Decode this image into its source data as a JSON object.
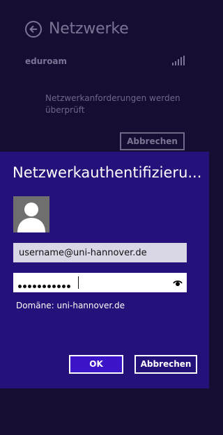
{
  "networks": {
    "title": "Netzwerke",
    "network_name": "eduroam",
    "status_text": "Netzwerkanforderungen werden überprüft",
    "cancel_label": "Abbrechen",
    "icons": {
      "back": "back-arrow-icon",
      "signal": "wifi-signal-icon"
    }
  },
  "dialog": {
    "title": "Netzwerkauthentifizieru...",
    "username_value": "username@uni-hannover.de",
    "password_masked": "●●●●●●●●●●●",
    "domain_text": "Domäne: uni-hannover.de",
    "ok_label": "OK",
    "cancel_label": "Abbrechen",
    "icons": {
      "avatar": "user-avatar-icon",
      "reveal": "eye-icon"
    }
  },
  "colors": {
    "background": "#170d33",
    "dialog": "#26107a",
    "ok_button": "#3c15c8",
    "dim_text": "#7b7594"
  }
}
